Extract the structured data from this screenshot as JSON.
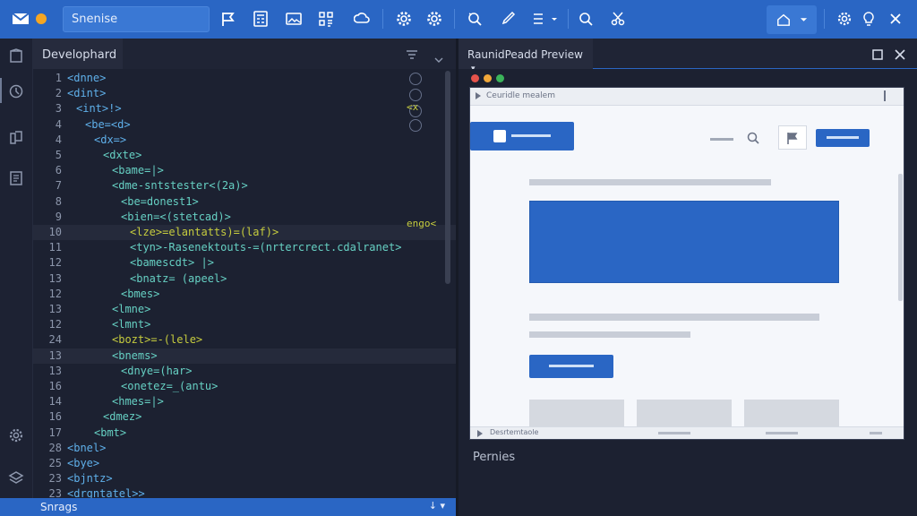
{
  "toolbar": {
    "search_value": "Snenise",
    "icons": [
      "mail-icon",
      "flag-icon",
      "calculator-icon",
      "image-icon",
      "grid-icon",
      "cloud-icon",
      "gear-icon",
      "settings-icon",
      "refresh-search-icon",
      "brush-icon",
      "list-dropdown-icon",
      "search-icon",
      "scissors-icon",
      "home-icon",
      "gear-small-icon",
      "bulb-icon",
      "close-icon"
    ],
    "accent": "#2a66c4",
    "dot_color": "#f5a623"
  },
  "editor": {
    "tab_label": "Develophard",
    "lines": [
      {
        "num": "1",
        "indent": 0,
        "text": "<dnne>",
        "cls": "t-tag"
      },
      {
        "num": "2",
        "indent": 0,
        "text": "<dint>",
        "cls": "t-tag"
      },
      {
        "num": "3",
        "indent": 1,
        "text": "<int>!>",
        "cls": "t-tag"
      },
      {
        "num": "4",
        "indent": 2,
        "text": "<be=<d>",
        "cls": "t-tag"
      },
      {
        "num": "4",
        "indent": 3,
        "text": "<dx=>",
        "cls": "t-tag"
      },
      {
        "num": "5",
        "indent": 4,
        "text": "<dxte>",
        "cls": "t-attr"
      },
      {
        "num": "6",
        "indent": 5,
        "text": "<bame=|>",
        "cls": "t-attr"
      },
      {
        "num": "7",
        "indent": 5,
        "text": "<dme-sntstester<(2a)>",
        "cls": "t-attr"
      },
      {
        "num": "8",
        "indent": 6,
        "text": "<be=donest1>",
        "cls": "t-attr"
      },
      {
        "num": "9",
        "indent": 6,
        "text": "<bien=<(stetcad)>",
        "cls": "t-attr"
      },
      {
        "num": "10",
        "indent": 7,
        "text": "<lze>=elantatts)=(laf)>",
        "cls": "t-br",
        "hl": true
      },
      {
        "num": "11",
        "indent": 7,
        "text": "<tyn>-Rasenektouts-=(nrtercrect.cdalranet>",
        "cls": "t-attr"
      },
      {
        "num": "12",
        "indent": 7,
        "text": "<bamescdt> |>",
        "cls": "t-attr"
      },
      {
        "num": "13",
        "indent": 7,
        "text": "<bnatz= (apeel>",
        "cls": "t-attr"
      },
      {
        "num": "12",
        "indent": 6,
        "text": "<bmes>",
        "cls": "t-attr"
      },
      {
        "num": "13",
        "indent": 5,
        "text": "<lmne>",
        "cls": "t-attr"
      },
      {
        "num": "12",
        "indent": 5,
        "text": "<lmnt>",
        "cls": "t-attr"
      },
      {
        "num": "24",
        "indent": 5,
        "text": "<bozt>=-(lele>",
        "cls": "t-br"
      },
      {
        "num": "13",
        "indent": 5,
        "text": "<bnems>",
        "cls": "t-attr",
        "hl": true
      },
      {
        "num": "13",
        "indent": 6,
        "text": "<dnye=(har>",
        "cls": "t-attr"
      },
      {
        "num": "16",
        "indent": 6,
        "text": "<onetez=_(antu>",
        "cls": "t-attr"
      },
      {
        "num": "14",
        "indent": 5,
        "text": "<hmes=|>",
        "cls": "t-attr"
      },
      {
        "num": "16",
        "indent": 4,
        "text": "<dmez>",
        "cls": "t-attr"
      },
      {
        "num": "17",
        "indent": 3,
        "text": "<bmt>",
        "cls": "t-attr"
      },
      {
        "num": "28",
        "indent": 0,
        "text": "<bnel>",
        "cls": "t-tag"
      },
      {
        "num": "25",
        "indent": 0,
        "text": "<bye>",
        "cls": "t-tag"
      },
      {
        "num": "23",
        "indent": 0,
        "text": "<bjntz>",
        "cls": "t-tag"
      },
      {
        "num": "23",
        "indent": 0,
        "text": "<drgntatel>>",
        "cls": "t-tag"
      }
    ],
    "side_note_1": "<x",
    "side_note_2": "engo<"
  },
  "statusbar": {
    "text": "Snrags",
    "icons": "↓ ▾"
  },
  "preview": {
    "tab_label": "RaunidPeadd Preview",
    "tab_caret": "▾",
    "browser_bar_text": "Ceuridle mealem",
    "browser_bottom_text": "Desrtemtaole",
    "panels_label": "Pernies",
    "dot_colors": [
      "#e5534b",
      "#f0a73a",
      "#3bb45a"
    ]
  }
}
